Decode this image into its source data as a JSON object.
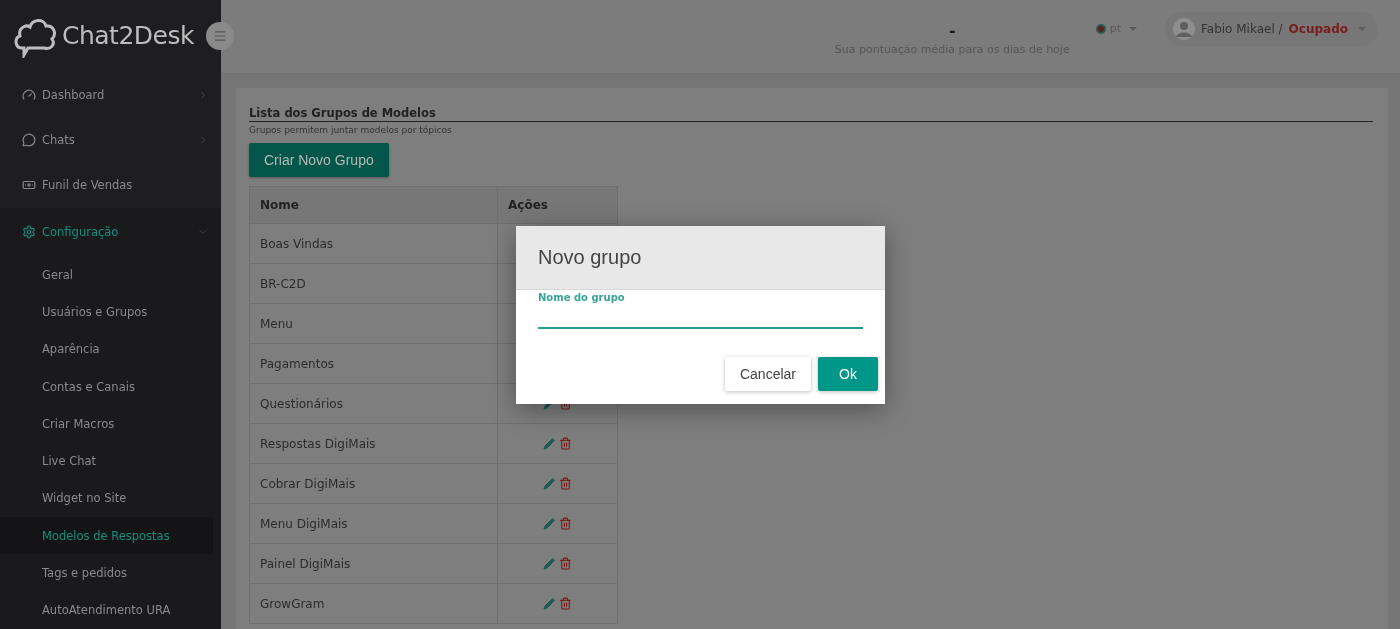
{
  "sidebar": {
    "logo": "Chat2Desk",
    "items": [
      {
        "label": "Dashboard",
        "selected": false,
        "expanded": false
      },
      {
        "label": "Chats",
        "selected": false,
        "expanded": false
      },
      {
        "label": "Funil de Vendas",
        "selected": false
      },
      {
        "label": "Configuração",
        "selected": true,
        "expanded": true,
        "children": [
          {
            "label": "Geral",
            "selected": false
          },
          {
            "label": "Usuários e Grupos",
            "selected": false
          },
          {
            "label": "Aparência",
            "selected": false
          },
          {
            "label": "Contas e Canais",
            "selected": false
          },
          {
            "label": "Criar Macros",
            "selected": false
          },
          {
            "label": "Live Chat",
            "selected": false
          },
          {
            "label": "Widget no Site",
            "selected": false
          },
          {
            "label": "Modelos de Respostas",
            "selected": true
          },
          {
            "label": "Tags e pedidos",
            "selected": false
          },
          {
            "label": "AutoAtendimento URA",
            "selected": false
          }
        ]
      }
    ]
  },
  "header": {
    "score": "-",
    "score_caption": "Sua pontuação média para os dias de hoje",
    "language": "pt",
    "user": {
      "name": "Fabio Mikael /",
      "status": "Ocupado"
    }
  },
  "panel": {
    "title": "Lista dos Grupos de Modelos",
    "subtitle": "Grupos permitem juntar modelos por tópicos",
    "create_button": "Criar Novo Grupo",
    "table": {
      "columns": [
        "Nome",
        "Ações"
      ],
      "rows": [
        {
          "name": "Boas Vindas"
        },
        {
          "name": "BR-C2D"
        },
        {
          "name": "Menu"
        },
        {
          "name": "Pagamentos"
        },
        {
          "name": "Questionários",
          "actions": true
        },
        {
          "name": "Respostas DigiMais",
          "actions": true
        },
        {
          "name": "Cobrar DigiMais",
          "actions": true
        },
        {
          "name": "Menu DigiMais",
          "actions": true
        },
        {
          "name": "Painel DigiMais",
          "actions": true
        },
        {
          "name": "GrowGram",
          "actions": true
        }
      ]
    }
  },
  "dialog": {
    "title": "Novo grupo",
    "field_label": "Nome do grupo",
    "buttons": [
      {
        "label": "Cancelar",
        "kind": "flat"
      },
      {
        "label": "Ok",
        "kind": "primary"
      }
    ]
  }
}
